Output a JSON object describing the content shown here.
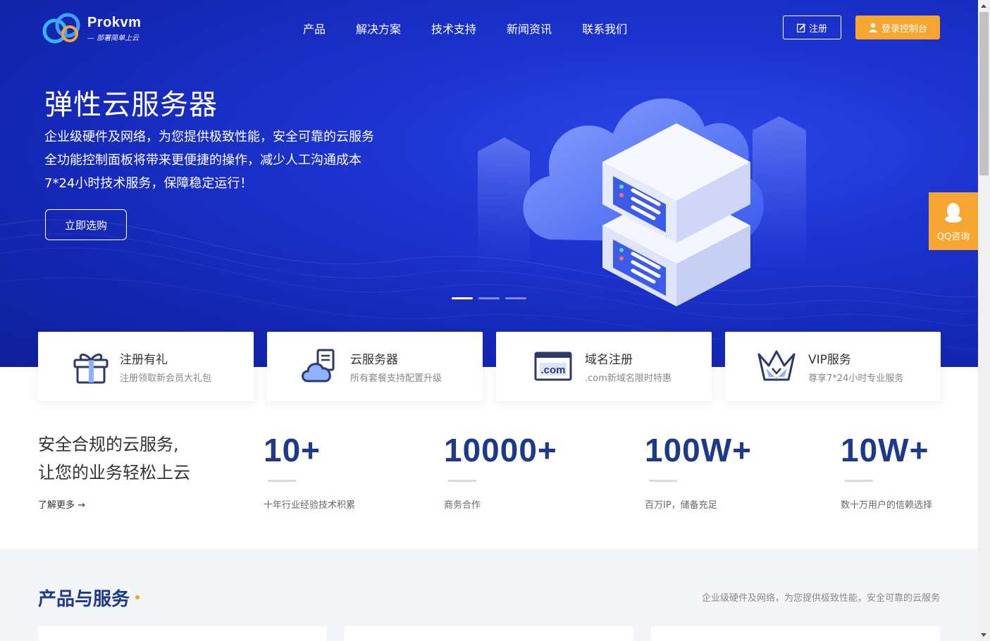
{
  "brand": {
    "name": "Prokvm",
    "slogan": "— 部署简单上云"
  },
  "nav": {
    "items": [
      "产品",
      "解决方案",
      "技术支持",
      "新闻资讯",
      "联系我们"
    ]
  },
  "header": {
    "register_label": "注册",
    "login_label": "登录控制台"
  },
  "hero": {
    "title": "弹性云服务器",
    "lines": [
      "企业级硬件及网络，为您提供极致性能，安全可靠的云服务",
      "全功能控制面板将带来更便捷的操作，减少人工沟通成本",
      "7*24小时技术服务，保障稳定运行！"
    ],
    "cta_label": "立即选购",
    "slides_total": 3,
    "slide_active": 1
  },
  "features": [
    {
      "title": "注册有礼",
      "subtitle": "注册领取新会员大礼包",
      "icon": "gift-icon"
    },
    {
      "title": "云服务器",
      "subtitle": "所有套餐支持配置升级",
      "icon": "cloud-server-icon"
    },
    {
      "title": "域名注册",
      "subtitle": ".com新域名限时特惠",
      "icon": "domain-com-icon"
    },
    {
      "title": "VIP服务",
      "subtitle": "尊享7*24小时专业服务",
      "icon": "crown-icon"
    }
  ],
  "intro": {
    "line1": "安全合规的云服务,",
    "line2": "让您的业务轻松上云",
    "more_label": "了解更多 →"
  },
  "stats": [
    {
      "value": "10+",
      "label": "十年行业经验技术积累"
    },
    {
      "value": "10000+",
      "label": "商务合作"
    },
    {
      "value": "100W+",
      "label": "百万IP，储备充足"
    },
    {
      "value": "10W+",
      "label": "数十万用户的信赖选择"
    }
  ],
  "products": {
    "title": "产品与服务",
    "subtitle": "企业级硬件及网络，为您提供极致性能，安全可靠的云服务"
  },
  "float": {
    "qq_label": "QQ咨询"
  },
  "colors": {
    "primary": "#1c33cf",
    "accent": "#f7a531",
    "stat_text": "#1d3a8a"
  }
}
